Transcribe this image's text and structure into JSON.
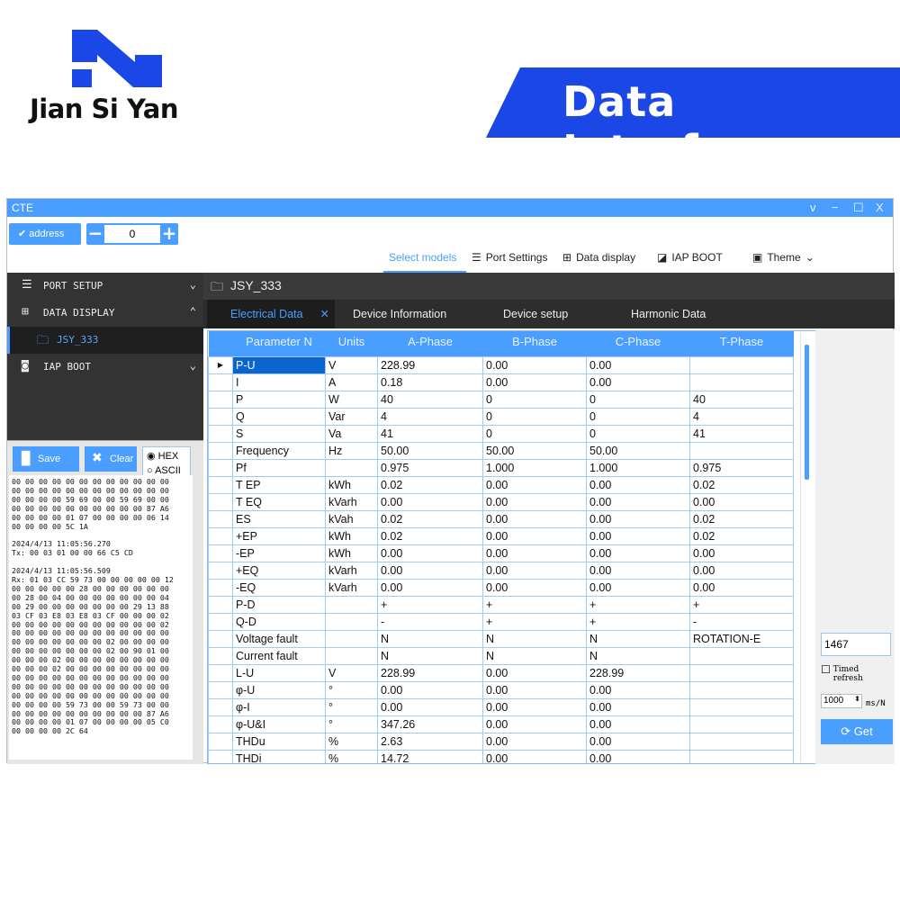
{
  "brand": {
    "name": "Jian Si Yan",
    "color": "#1a47e6"
  },
  "banner": {
    "title": "Data Interface"
  },
  "window": {
    "title": "CTE",
    "controls": [
      "v",
      "−",
      "☐",
      "X"
    ]
  },
  "toolbar": {
    "address_label": "address",
    "stepper_value": "0",
    "minus": "−",
    "plus": "+",
    "menus": [
      {
        "label": "Select models",
        "icon": ""
      },
      {
        "label": "Port Settings",
        "icon": "list-icon"
      },
      {
        "label": "Data display",
        "icon": "windows-icon"
      },
      {
        "label": "IAP BOOT",
        "icon": "pen-icon"
      },
      {
        "label": "Theme",
        "icon": "image-icon"
      }
    ]
  },
  "sidebar": {
    "items": [
      {
        "label": "PORT SETUP",
        "icon": "☰",
        "chev": "⌄"
      },
      {
        "label": "DATA DISPLAY",
        "icon": "⊞",
        "chev": "⌃"
      },
      {
        "label": "JSY_333",
        "icon": "🗀"
      },
      {
        "label": "IAP BOOT",
        "icon": "◙",
        "chev": "⌄"
      }
    ]
  },
  "log": {
    "save": "Save",
    "clear": "Clear",
    "hex": "HEX",
    "ascii": "ASCII",
    "mode": "HEX",
    "text": "00 00 00 00 00 00 00 00 00 00 00 00\n00 00 00 00 00 00 00 00 00 00 00 00\n00 00 00 00 59 69 00 00 59 69 00 00\n00 00 00 00 00 00 00 00 00 00 87 A6\n00 00 00 00 01 07 00 00 00 00 06 14\n00 00 00 00 5C 1A\n\n2024/4/13 11:05:56.270\nTx: 00 03 01 00 00 66 C5 CD\n\n2024/4/13 11:05:56.509\nRx: 01 03 CC 59 73 00 00 00 00 00 12\n00 00 00 00 00 28 00 00 00 00 00 00\n00 28 00 04 00 00 00 00 00 00 00 04\n00 29 00 00 00 00 00 00 00 29 13 88\n03 CF 03 E8 03 E8 03 CF 00 00 00 02\n00 00 00 00 00 00 00 00 00 00 00 02\n00 00 00 00 00 00 00 00 00 00 00 00\n00 00 00 00 00 00 00 02 00 00 00 00\n00 00 00 00 00 00 00 02 00 90 01 00\n00 00 00 02 00 00 00 00 00 00 00 00\n00 00 00 02 00 00 00 00 00 00 00 00\n00 00 00 00 00 00 00 00 00 00 00 00\n00 00 00 00 00 00 00 00 00 00 00 00\n00 00 00 00 00 00 00 00 00 00 00 00\n00 00 00 00 59 73 00 00 59 73 00 00\n00 00 00 00 00 00 00 00 00 00 87 A6\n00 00 00 00 01 07 00 00 00 00 05 C0\n00 00 00 00 2C 64"
  },
  "main": {
    "device": "JSY_333",
    "tabs": [
      "Electrical Data",
      "Device Information",
      "Device setup",
      "Harmonic Data"
    ],
    "close": "✕",
    "columns": [
      "Parameter N",
      "Units",
      "A-Phase",
      "B-Phase",
      "C-Phase",
      "T-Phase"
    ],
    "rows": [
      [
        "P-U",
        "V",
        "228.99",
        "0.00",
        "0.00",
        ""
      ],
      [
        "I",
        "A",
        "0.18",
        "0.00",
        "0.00",
        ""
      ],
      [
        "P",
        "W",
        "40",
        "0",
        "0",
        "40"
      ],
      [
        "Q",
        "Var",
        "4",
        "0",
        "0",
        "4"
      ],
      [
        "S",
        "Va",
        "41",
        "0",
        "0",
        "41"
      ],
      [
        "Frequency",
        "Hz",
        "50.00",
        "50.00",
        "50.00",
        ""
      ],
      [
        "Pf",
        "",
        "0.975",
        "1.000",
        "1.000",
        "0.975"
      ],
      [
        "T EP",
        "kWh",
        "0.02",
        "0.00",
        "0.00",
        "0.02"
      ],
      [
        "T EQ",
        "kVarh",
        "0.00",
        "0.00",
        "0.00",
        "0.00"
      ],
      [
        "ES",
        "kVah",
        "0.02",
        "0.00",
        "0.00",
        "0.02"
      ],
      [
        "+EP",
        "kWh",
        "0.02",
        "0.00",
        "0.00",
        "0.02"
      ],
      [
        "-EP",
        "kWh",
        "0.00",
        "0.00",
        "0.00",
        "0.00"
      ],
      [
        "+EQ",
        "kVarh",
        "0.00",
        "0.00",
        "0.00",
        "0.00"
      ],
      [
        "-EQ",
        "kVarh",
        "0.00",
        "0.00",
        "0.00",
        "0.00"
      ],
      [
        "P-D",
        "",
        "+",
        "+",
        "+",
        "+"
      ],
      [
        "Q-D",
        "",
        "-",
        "+",
        "+",
        "-"
      ],
      [
        "Voltage fault",
        "",
        "N",
        "N",
        "N",
        "ROTATION-E"
      ],
      [
        "Current fault",
        "",
        "N",
        "N",
        "N",
        ""
      ],
      [
        "L-U",
        "V",
        "228.99",
        "0.00",
        "228.99",
        ""
      ],
      [
        "φ-U",
        "°",
        "0.00",
        "0.00",
        "0.00",
        ""
      ],
      [
        "φ-I",
        "°",
        "0.00",
        "0.00",
        "0.00",
        ""
      ],
      [
        "φ-U&I",
        "°",
        "347.26",
        "0.00",
        "0.00",
        ""
      ],
      [
        "THDu",
        "%",
        "2.63",
        "0.00",
        "0.00",
        ""
      ],
      [
        "THDi",
        "%",
        "14.72",
        "0.00",
        "0.00",
        ""
      ]
    ]
  },
  "right": {
    "count": "1467",
    "timed_label": "Timed refresh",
    "timed_checked": false,
    "interval": "1000",
    "unit": "ms/N",
    "get": "Get"
  }
}
